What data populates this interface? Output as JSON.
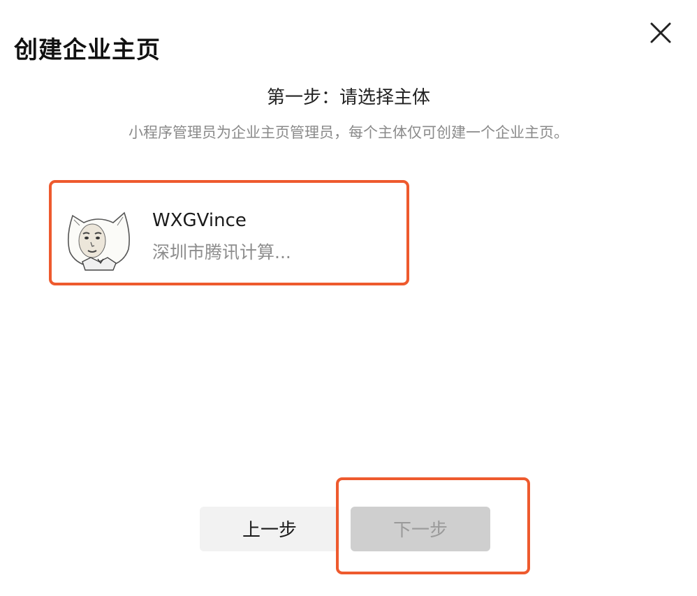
{
  "dialog": {
    "title": "创建企业主页",
    "close_icon": "close-icon"
  },
  "step": {
    "title": "第一步：请选择主体",
    "description": "小程序管理员为企业主页管理员，每个主体仅可创建一个企业主页。"
  },
  "entity": {
    "name": "WXGVince",
    "company": "深圳市腾讯计算...",
    "avatar_icon": "cat-face-avatar"
  },
  "buttons": {
    "prev_label": "上一步",
    "next_label": "下一步",
    "next_disabled": true
  },
  "colors": {
    "highlight": "#ee5a2e",
    "prev_bg": "#f2f2f2",
    "next_bg_disabled": "#cfcfcf",
    "muted_text": "#8a8a8a"
  }
}
